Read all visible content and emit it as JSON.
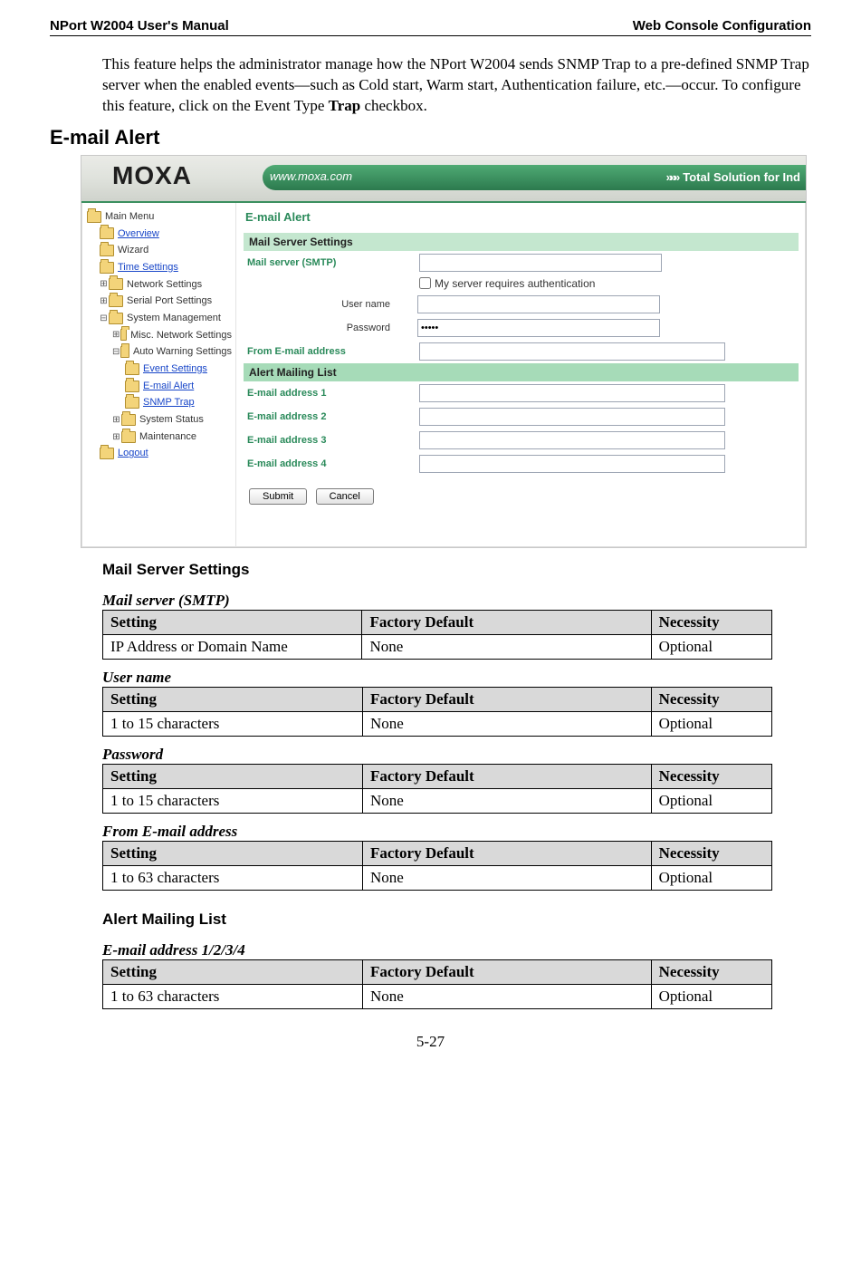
{
  "header": {
    "left": "NPort W2004 User's Manual",
    "right": "Web Console Configuration"
  },
  "intro": {
    "text_a": "This feature helps the administrator manage how the NPort W2004 sends SNMP Trap to a pre-defined SNMP Trap server when the enabled events—such as Cold start, Warm start, Authentication failure, etc.—occur. To configure this feature, click on the Event Type ",
    "bold": "Trap",
    "text_b": " checkbox."
  },
  "section_heading": "E-mail Alert",
  "screenshot": {
    "brand": "MOXA",
    "brand_url": "www.moxa.com",
    "tagline": "Total Solution for Ind",
    "nav": {
      "main_menu": "Main Menu",
      "overview": "Overview",
      "wizard": "Wizard",
      "time_settings": "Time Settings",
      "network_settings": "Network Settings",
      "serial_port_settings": "Serial Port Settings",
      "system_management": "System Management",
      "misc_network": "Misc. Network Settings",
      "auto_warning": "Auto Warning Settings",
      "event_settings": "Event Settings",
      "email_alert": "E-mail Alert",
      "snmp_trap": "SNMP Trap",
      "system_status": "System Status",
      "maintenance": "Maintenance",
      "logout": "Logout"
    },
    "content": {
      "title": "E-mail Alert",
      "mail_server_bar": "Mail Server Settings",
      "mail_server_label": "Mail server (SMTP)",
      "auth_cb_label": "My server requires authentication",
      "username_label": "User name",
      "password_label": "Password",
      "password_value": "•••••",
      "from_email_label": "From E-mail address",
      "alert_list_bar": "Alert Mailing List",
      "email1": "E-mail address 1",
      "email2": "E-mail address 2",
      "email3": "E-mail address 3",
      "email4": "E-mail address 4",
      "submit": "Submit",
      "cancel": "Cancel"
    }
  },
  "sub_heading_1": "Mail Server Settings",
  "tables": {
    "headers": {
      "setting": "Setting",
      "default": "Factory Default",
      "necessity": "Necessity"
    },
    "mail_server": {
      "title": "Mail server (SMTP)",
      "row": {
        "setting": "IP Address or Domain Name",
        "default": "None",
        "necessity": "Optional"
      }
    },
    "user_name": {
      "title": "User name",
      "row": {
        "setting": "1 to 15 characters",
        "default": "None",
        "necessity": "Optional"
      }
    },
    "password": {
      "title": "Password",
      "row": {
        "setting": "1 to 15 characters",
        "default": "None",
        "necessity": "Optional"
      }
    },
    "from_email": {
      "title": "From E-mail address",
      "row": {
        "setting": "1 to 63 characters",
        "default": "None",
        "necessity": "Optional"
      }
    },
    "email_1234": {
      "title": "E-mail address 1/2/3/4",
      "row": {
        "setting": "1 to 63 characters",
        "default": "None",
        "necessity": "Optional"
      }
    }
  },
  "sub_heading_2": "Alert Mailing List",
  "page_number": "5-27"
}
